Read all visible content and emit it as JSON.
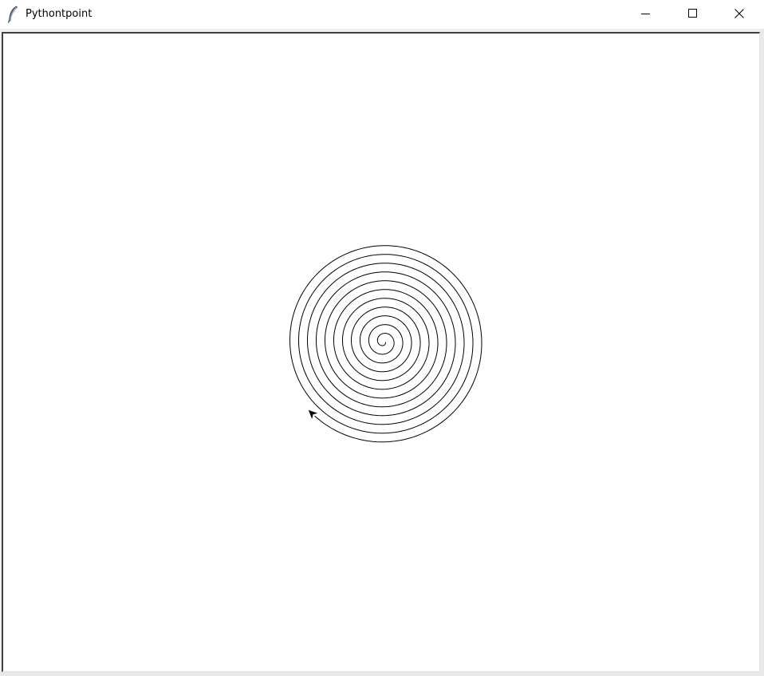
{
  "window": {
    "title": "Pythontpoint",
    "icon": "feather-icon",
    "controls": {
      "minimize": "minimize-icon",
      "maximize": "maximize-icon",
      "close": "close-icon"
    }
  },
  "canvas": {
    "background": "#ffffff",
    "drawing": {
      "shape": "spiral",
      "stroke_color": "#000000",
      "turtle_color": "#000000",
      "turns": 11
    }
  }
}
